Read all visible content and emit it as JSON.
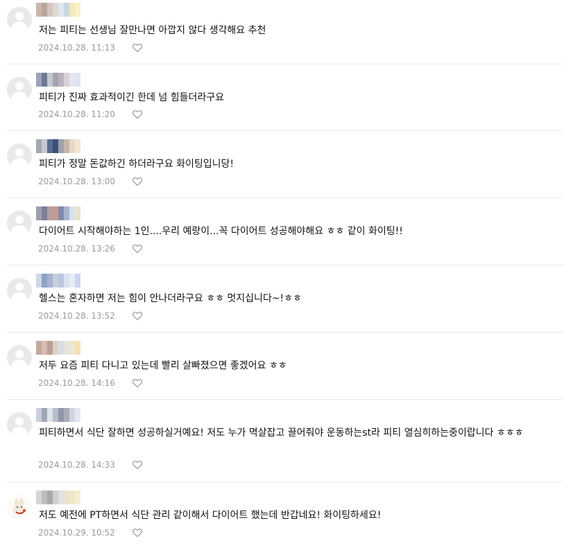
{
  "comments": [
    {
      "text": "저는 피티는 선생님 잘만나면 아깝지 않다 생각해요 추천",
      "date": "2024.10.28. 11:13",
      "nick_colors": [
        "#c9b6ad",
        "#b8a59c",
        "#d4c7c0",
        "#e2d8d2",
        "#dde7ef",
        "#cbd7e0",
        "#f1e9bf",
        "#fbf1c4"
      ]
    },
    {
      "text": "피티가 진짜 효과적이긴 한데 넘 힘들더라구요",
      "date": "2024.10.28. 11:20",
      "nick_colors": [
        "#9aa3b8",
        "#6f7890",
        "#c4c9d6",
        "#a6a3ab",
        "#b8b4c0",
        "#d6d2dc",
        "#e9e7ee",
        "#dde4f2"
      ]
    },
    {
      "text": "피티가 정말 돈값하긴 하더라구요 화이팅입니당!",
      "date": "2024.10.28. 13:00",
      "nick_colors": [
        "#a3a8b3",
        "#c7c9cf",
        "#5a6c8f",
        "#3c4f78",
        "#9ea2ad",
        "#c3b7ad",
        "#e8d9c6",
        "#f3e6d4"
      ]
    },
    {
      "text": "다이어트 시작해야하는 1인....우리 예랑이...꼭 다이어트 성공해야해요 ㅎㅎ 같이 화이팅!!",
      "date": "2024.10.28. 13:26",
      "nick_colors": [
        "#9e9fae",
        "#7c7f96",
        "#b39fa3",
        "#c79a8e",
        "#7f8aa8",
        "#a9b4cf",
        "#d6e2ef",
        "#e9e3cf"
      ]
    },
    {
      "text": "헬스는 혼자하면 저는 힘이 안나더라구요 ㅎㅎ 멋지십니다~!ㅎㅎ",
      "date": "2024.10.28. 13:52",
      "nick_colors": [
        "#cfd6e6",
        "#8ea2c4",
        "#a6b5d0",
        "#c7cfdf",
        "#b9c6dc",
        "#d9e2ef",
        "#e6ecf5",
        "#c9d6ee"
      ]
    },
    {
      "text": "저두 요즘 피티 다니고 있는데 빨리 살빠졌으면 좋겠어요 ㅎㅎ",
      "date": "2024.10.28. 14:16",
      "nick_colors": [
        "#c2a79b",
        "#d4beb2",
        "#b9a195",
        "#e0d0c6",
        "#d9dde4",
        "#e6e4dc",
        "#ece7d5",
        "#f4e3b2"
      ]
    },
    {
      "text": "피티하면서 식단 잘하면 성공하실거예요! 저도 누가 멱살잡고 끌어줘야 운동하는st라 피티 열심히하는중이랍니다 ㅎㅎㅎ",
      "date": "2024.10.28. 14:33",
      "nick_colors": [
        "#c9cfda",
        "#9ea6b6",
        "#dfe2e8",
        "#b8bdc8",
        "#8f97aa",
        "#a8adb8",
        "#ced5e2",
        "#e4e8ee"
      ]
    },
    {
      "text": "저도 예전에 PT하면서 식단 관리 같이해서 다이어트 했는데 반갑네요! 화이팅하세요!",
      "date": "2024.10.29. 10:52",
      "nick_colors": [
        "#d6d6d6",
        "#bdbdbd",
        "#a9a9a9",
        "#cfcfcf",
        "#e1e1e1",
        "#e9e3cf",
        "#f0e8c9",
        "#f6efd3"
      ]
    }
  ],
  "icons": {
    "avatar": "default-profile-icon",
    "custom_avatar": "rabbit-profile-image",
    "like": "heart-outline-icon"
  },
  "colors": {
    "text": "#111111",
    "date": "#9a9a9a",
    "divider": "#ebebeb",
    "avatar_bg": "#e9e9e9"
  }
}
